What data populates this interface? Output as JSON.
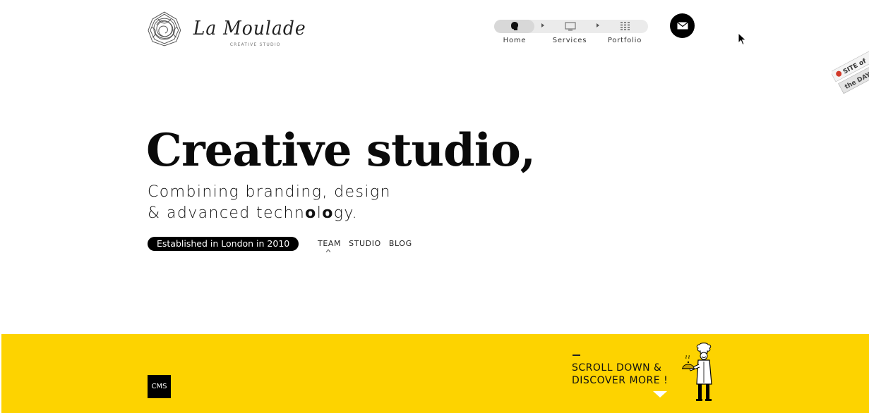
{
  "brand": {
    "logo_script": "La Moulade",
    "logo_sub": "CREATIVE STUDIO"
  },
  "nav": {
    "items": [
      {
        "label": "Home",
        "icon": "head-icon",
        "active": true
      },
      {
        "label": "Services",
        "icon": "monitor-icon",
        "active": false
      },
      {
        "label": "Portfolio",
        "icon": "grid-icon",
        "active": false
      }
    ],
    "contact_icon": "envelope-icon"
  },
  "ribbon": {
    "line1": "SITE of",
    "line2": "the DAY"
  },
  "hero": {
    "title": "Creative studio,",
    "sub_line1": "Combining branding, design",
    "sub_line2_pre": "& advanced techn",
    "sub_line2_bold1": "o",
    "sub_line2_mid": "l",
    "sub_line2_bold2": "o",
    "sub_line2_post": "gy."
  },
  "badge": "Established in London in 2010",
  "sublinks": [
    "TEAM",
    "STUDIO",
    "BLOG"
  ],
  "band": {
    "cms_label": "CMS",
    "scroll_line1": "SCROLL DOWN &",
    "scroll_line2": "DISCOVER MORE !",
    "color": "#fdd300"
  }
}
